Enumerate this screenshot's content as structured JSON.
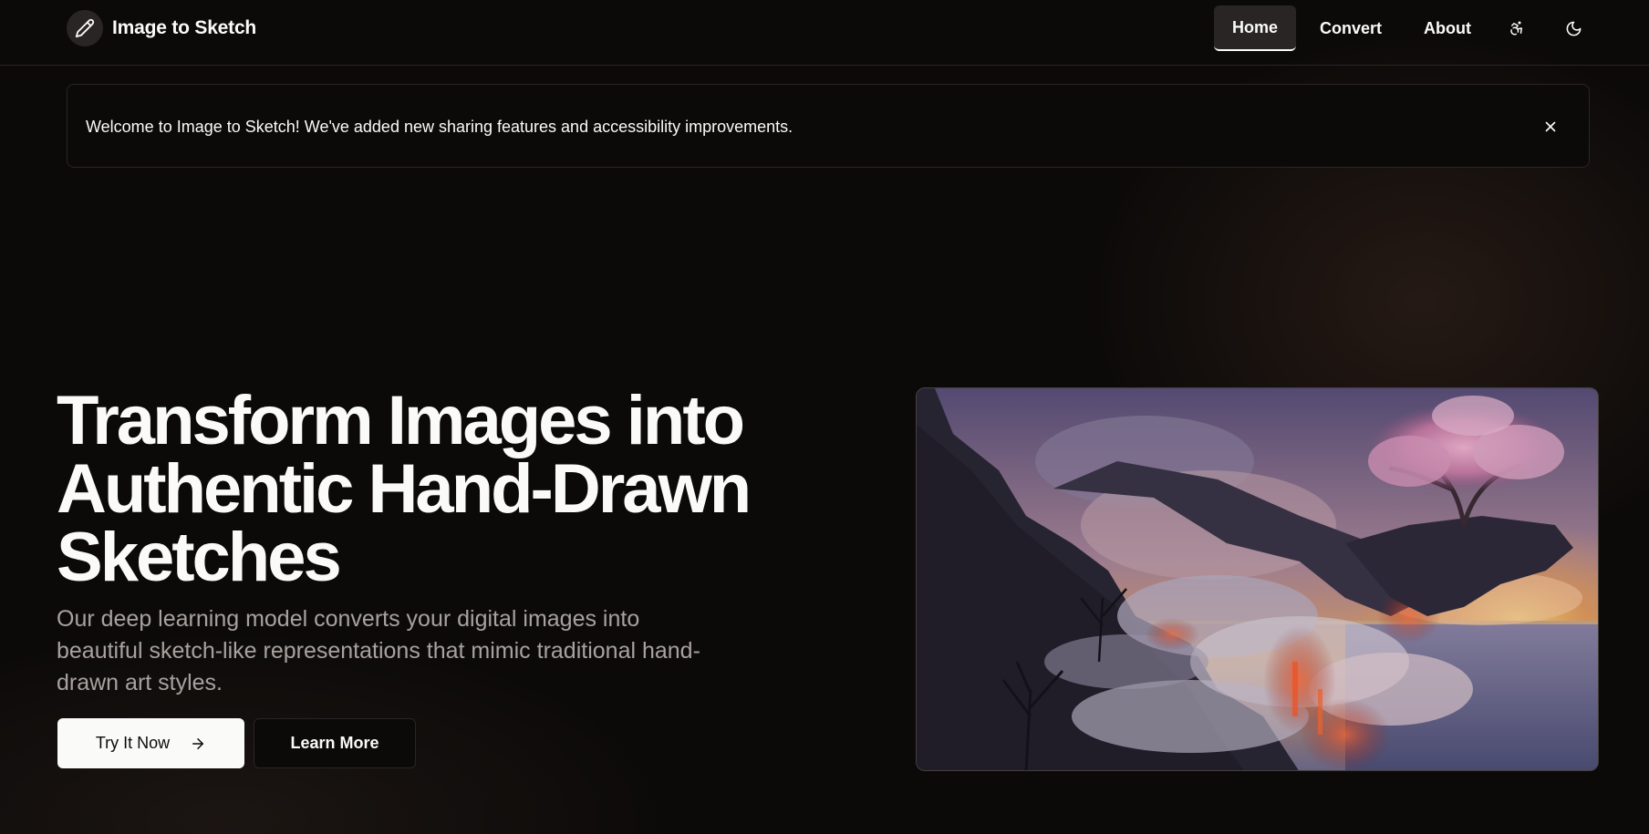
{
  "header": {
    "brand": {
      "name": "Image to Sketch",
      "icon": "pencil-icon"
    },
    "nav": [
      {
        "label": "Home",
        "active": true
      },
      {
        "label": "Convert",
        "active": false
      },
      {
        "label": "About",
        "active": false
      }
    ],
    "icons": {
      "accessibility": "accessibility-icon",
      "theme": "moon-icon"
    }
  },
  "banner": {
    "text": "Welcome to Image to Sketch! We've added new sharing features and accessibility improvements.",
    "close_icon": "close-icon"
  },
  "hero": {
    "title": "Transform Images into Authentic Hand-Drawn Sketches",
    "subtitle": "Our deep learning model converts your digital images into beautiful sketch-like representations that mimic traditional hand-drawn art styles.",
    "primary_button": {
      "label": "Try It Now",
      "icon": "arrow-right-icon"
    },
    "secondary_button": {
      "label": "Learn More"
    },
    "image": {
      "subject": "fantasy landscape with a pink blossom tree on a cliff above smoke and lava"
    }
  },
  "colors": {
    "background": "#0c0a09",
    "border": "#292524",
    "text": "#fafaf9",
    "muted_text": "#a8a29e",
    "primary_button_bg": "#fafaf9"
  }
}
